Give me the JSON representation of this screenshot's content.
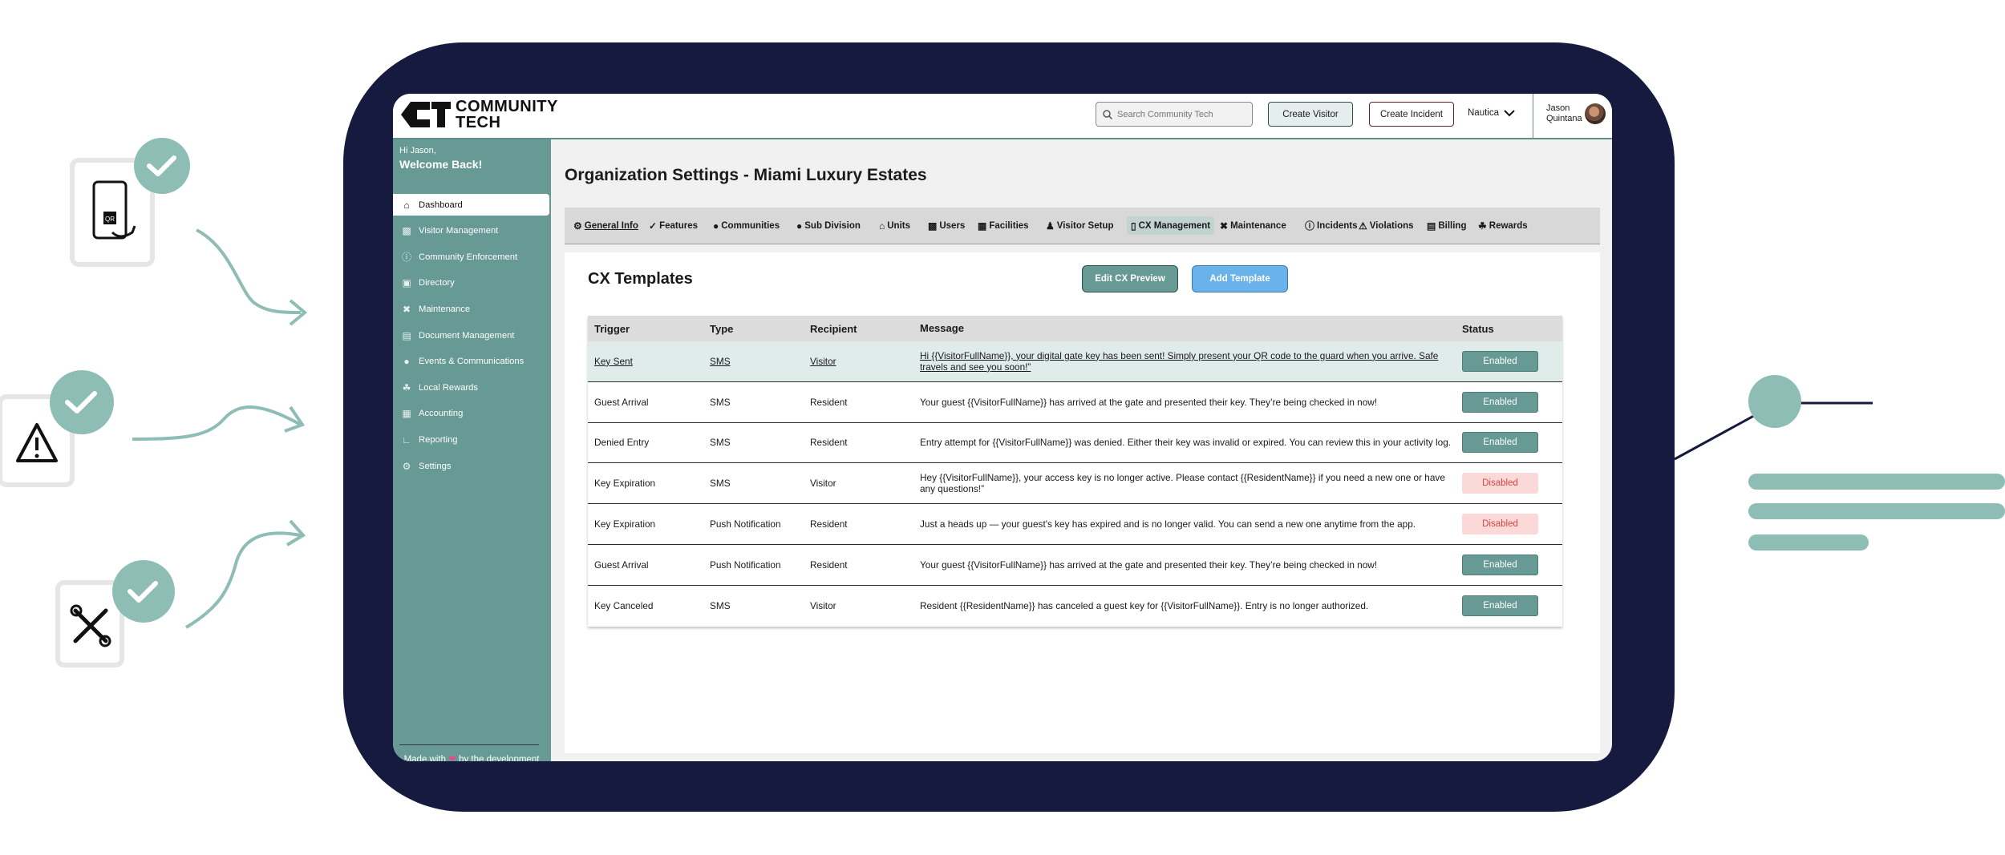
{
  "brand": {
    "logo_mark": "CT",
    "logo_line1": "COMMUNITY",
    "logo_line2": "TECH"
  },
  "header": {
    "search_placeholder": "Search Community Tech",
    "create_visitor": "Create Visitor",
    "create_incident": "Create Incident",
    "community": "Nautica",
    "user_first": "Jason",
    "user_last": "Quintana"
  },
  "sidebar": {
    "greeting": "Hi Jason,",
    "welcome": "Welcome Back!",
    "items": [
      {
        "label": "Dashboard",
        "icon": "home-icon"
      },
      {
        "label": "Visitor Management",
        "icon": "visitor-icon"
      },
      {
        "label": "Community Enforcement",
        "icon": "info-icon"
      },
      {
        "label": "Directory",
        "icon": "directory-icon"
      },
      {
        "label": "Maintenance",
        "icon": "tools-icon"
      },
      {
        "label": "Document Management",
        "icon": "document-icon"
      },
      {
        "label": "Events & Communications",
        "icon": "events-icon"
      },
      {
        "label": "Local Rewards",
        "icon": "rewards-icon"
      },
      {
        "label": "Accounting",
        "icon": "accounting-icon"
      },
      {
        "label": "Reporting",
        "icon": "chart-icon"
      },
      {
        "label": "Settings",
        "icon": "gear-icon"
      }
    ],
    "footer_pre": "Made with",
    "footer_post": "by the development team at Community Tech"
  },
  "page": {
    "title": "Organization Settings - Miami Luxury Estates"
  },
  "tabs": [
    {
      "label": "General Info",
      "icon": "gear-icon"
    },
    {
      "label": "Features",
      "icon": "check-icon"
    },
    {
      "label": "Communities",
      "icon": "group-icon"
    },
    {
      "label": "Sub Division",
      "icon": "group-icon"
    },
    {
      "label": "Units",
      "icon": "home-icon"
    },
    {
      "label": "Users",
      "icon": "user-card-icon"
    },
    {
      "label": "Facilities",
      "icon": "building-icon"
    },
    {
      "label": "Visitor Setup",
      "icon": "person-icon"
    },
    {
      "label": "CX Management",
      "icon": "phone-icon"
    },
    {
      "label": "Maintenance",
      "icon": "tools-icon"
    },
    {
      "label": "Incidents",
      "icon": "info-icon"
    },
    {
      "label": "Violations",
      "icon": "warning-icon"
    },
    {
      "label": "Billing",
      "icon": "billing-icon"
    },
    {
      "label": "Rewards",
      "icon": "rewards-icon"
    }
  ],
  "panel": {
    "title": "CX Templates",
    "edit_preview": "Edit CX Preview",
    "add_template": "Add Template"
  },
  "table": {
    "headers": {
      "trigger": "Trigger",
      "type": "Type",
      "recipient": "Recipient",
      "message": "Message",
      "status": "Status"
    },
    "rows": [
      {
        "trigger": "Key Sent",
        "type": "SMS",
        "recipient": "Visitor",
        "message": "Hi {{VisitorFullName}}, your digital gate key has been sent! Simply present your QR code to the guard when you arrive. Safe travels and see you soon!”",
        "status": "Enabled"
      },
      {
        "trigger": "Guest Arrival",
        "type": "SMS",
        "recipient": "Resident",
        "message": "Your guest {{VisitorFullName}} has arrived at the gate and presented their key. They’re being checked in now!",
        "status": "Enabled"
      },
      {
        "trigger": "Denied Entry",
        "type": "SMS",
        "recipient": "Resident",
        "message": "Entry attempt for {{VisitorFullName}} was denied. Either their key was invalid or expired. You can review this in your activity log.",
        "status": "Enabled"
      },
      {
        "trigger": "Key Expiration",
        "type": "SMS",
        "recipient": "Visitor",
        "message": "Hey {{VisitorFullName}}, your access key is no longer active. Please contact {{ResidentName}} if you need a new one or have any questions!”",
        "status": "Disabled"
      },
      {
        "trigger": "Key Expiration",
        "type": "Push Notification",
        "recipient": "Resident",
        "message": "Just a heads up — your guest's key has expired and is no longer valid. You can send a new one anytime from the app.",
        "status": "Disabled"
      },
      {
        "trigger": "Guest Arrival",
        "type": "Push Notification",
        "recipient": "Resident",
        "message": "Your guest {{VisitorFullName}} has arrived at the gate and presented their key. They’re being checked in now!",
        "status": "Enabled"
      },
      {
        "trigger": "Key Canceled",
        "type": "SMS",
        "recipient": "Visitor",
        "message": "Resident {{ResidentName}} has canceled a guest key for {{VisitorFullName}}. Entry is no longer authorized.",
        "status": "Enabled"
      }
    ]
  },
  "decor": {
    "qr_label": "QR"
  },
  "colors": {
    "teal": "#679a94",
    "navy": "#171a3f",
    "blue": "#6ab3ea",
    "disabled_bg": "#fbd9d9",
    "disabled_text": "#d64545"
  }
}
